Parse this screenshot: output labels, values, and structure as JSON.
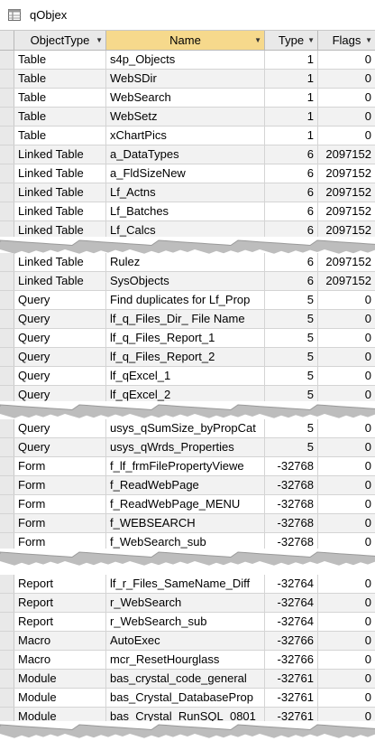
{
  "window": {
    "title": "qObjex"
  },
  "columns": [
    {
      "label": "ObjectType"
    },
    {
      "label": "Name"
    },
    {
      "label": "Type"
    },
    {
      "label": "Flags"
    }
  ],
  "sections": [
    {
      "rows": [
        [
          "Table",
          "s4p_Objects",
          "1",
          "0"
        ],
        [
          "Table",
          "WebSDir",
          "1",
          "0"
        ],
        [
          "Table",
          "WebSearch",
          "1",
          "0"
        ],
        [
          "Table",
          "WebSetz",
          "1",
          "0"
        ],
        [
          "Table",
          "xChartPics",
          "1",
          "0"
        ],
        [
          "Linked  Table",
          "a_DataTypes",
          "6",
          "2097152"
        ],
        [
          "Linked  Table",
          "a_FldSizeNew",
          "6",
          "2097152"
        ],
        [
          "Linked  Table",
          "Lf_Actns",
          "6",
          "2097152"
        ],
        [
          "Linked  Table",
          "Lf_Batches",
          "6",
          "2097152"
        ],
        [
          "Linked  Table",
          "Lf_Calcs",
          "6",
          "2097152"
        ]
      ]
    },
    {
      "rows": [
        [
          "Linked  Table",
          "Rulez",
          "6",
          "2097152"
        ],
        [
          "Linked  Table",
          "SysObjects",
          "6",
          "2097152"
        ],
        [
          "Query",
          "Find duplicates for Lf_Prop",
          "5",
          "0"
        ],
        [
          "Query",
          "lf_q_Files_Dir_ File Name",
          "5",
          "0"
        ],
        [
          "Query",
          "lf_q_Files_Report_1",
          "5",
          "0"
        ],
        [
          "Query",
          "lf_q_Files_Report_2",
          "5",
          "0"
        ],
        [
          "Query",
          "lf_qExcel_1",
          "5",
          "0"
        ],
        [
          "Query",
          "lf_qExcel_2",
          "5",
          "0"
        ]
      ]
    },
    {
      "rows": [
        [
          "Query",
          "usys_qSumSize_byPropCat",
          "5",
          "0"
        ],
        [
          "Query",
          "usys_qWrds_Properties",
          "5",
          "0"
        ],
        [
          "Form",
          "f_lf_frmFilePropertyViewe",
          "-32768",
          "0"
        ],
        [
          "Form",
          "f_ReadWebPage",
          "-32768",
          "0"
        ],
        [
          "Form",
          "f_ReadWebPage_MENU",
          "-32768",
          "0"
        ],
        [
          "Form",
          "f_WEBSEARCH",
          "-32768",
          "0"
        ],
        [
          "Form",
          "f_WebSearch_sub",
          "-32768",
          "0"
        ]
      ]
    },
    {
      "rows": [
        [
          "Report",
          "lf_r_Files_SameName_Diff",
          "-32764",
          "0"
        ],
        [
          "Report",
          "r_WebSearch",
          "-32764",
          "0"
        ],
        [
          "Report",
          "r_WebSearch_sub",
          "-32764",
          "0"
        ],
        [
          "Macro",
          "AutoExec",
          "-32766",
          "0"
        ],
        [
          "Macro",
          "mcr_ResetHourglass",
          "-32766",
          "0"
        ],
        [
          "Module",
          "bas_crystal_code_general",
          "-32761",
          "0"
        ],
        [
          "Module",
          "bas_Crystal_DatabaseProp",
          "-32761",
          "0"
        ],
        [
          "Module",
          "bas_Crystal_RunSQL_0801",
          "-32761",
          "0"
        ]
      ]
    }
  ]
}
